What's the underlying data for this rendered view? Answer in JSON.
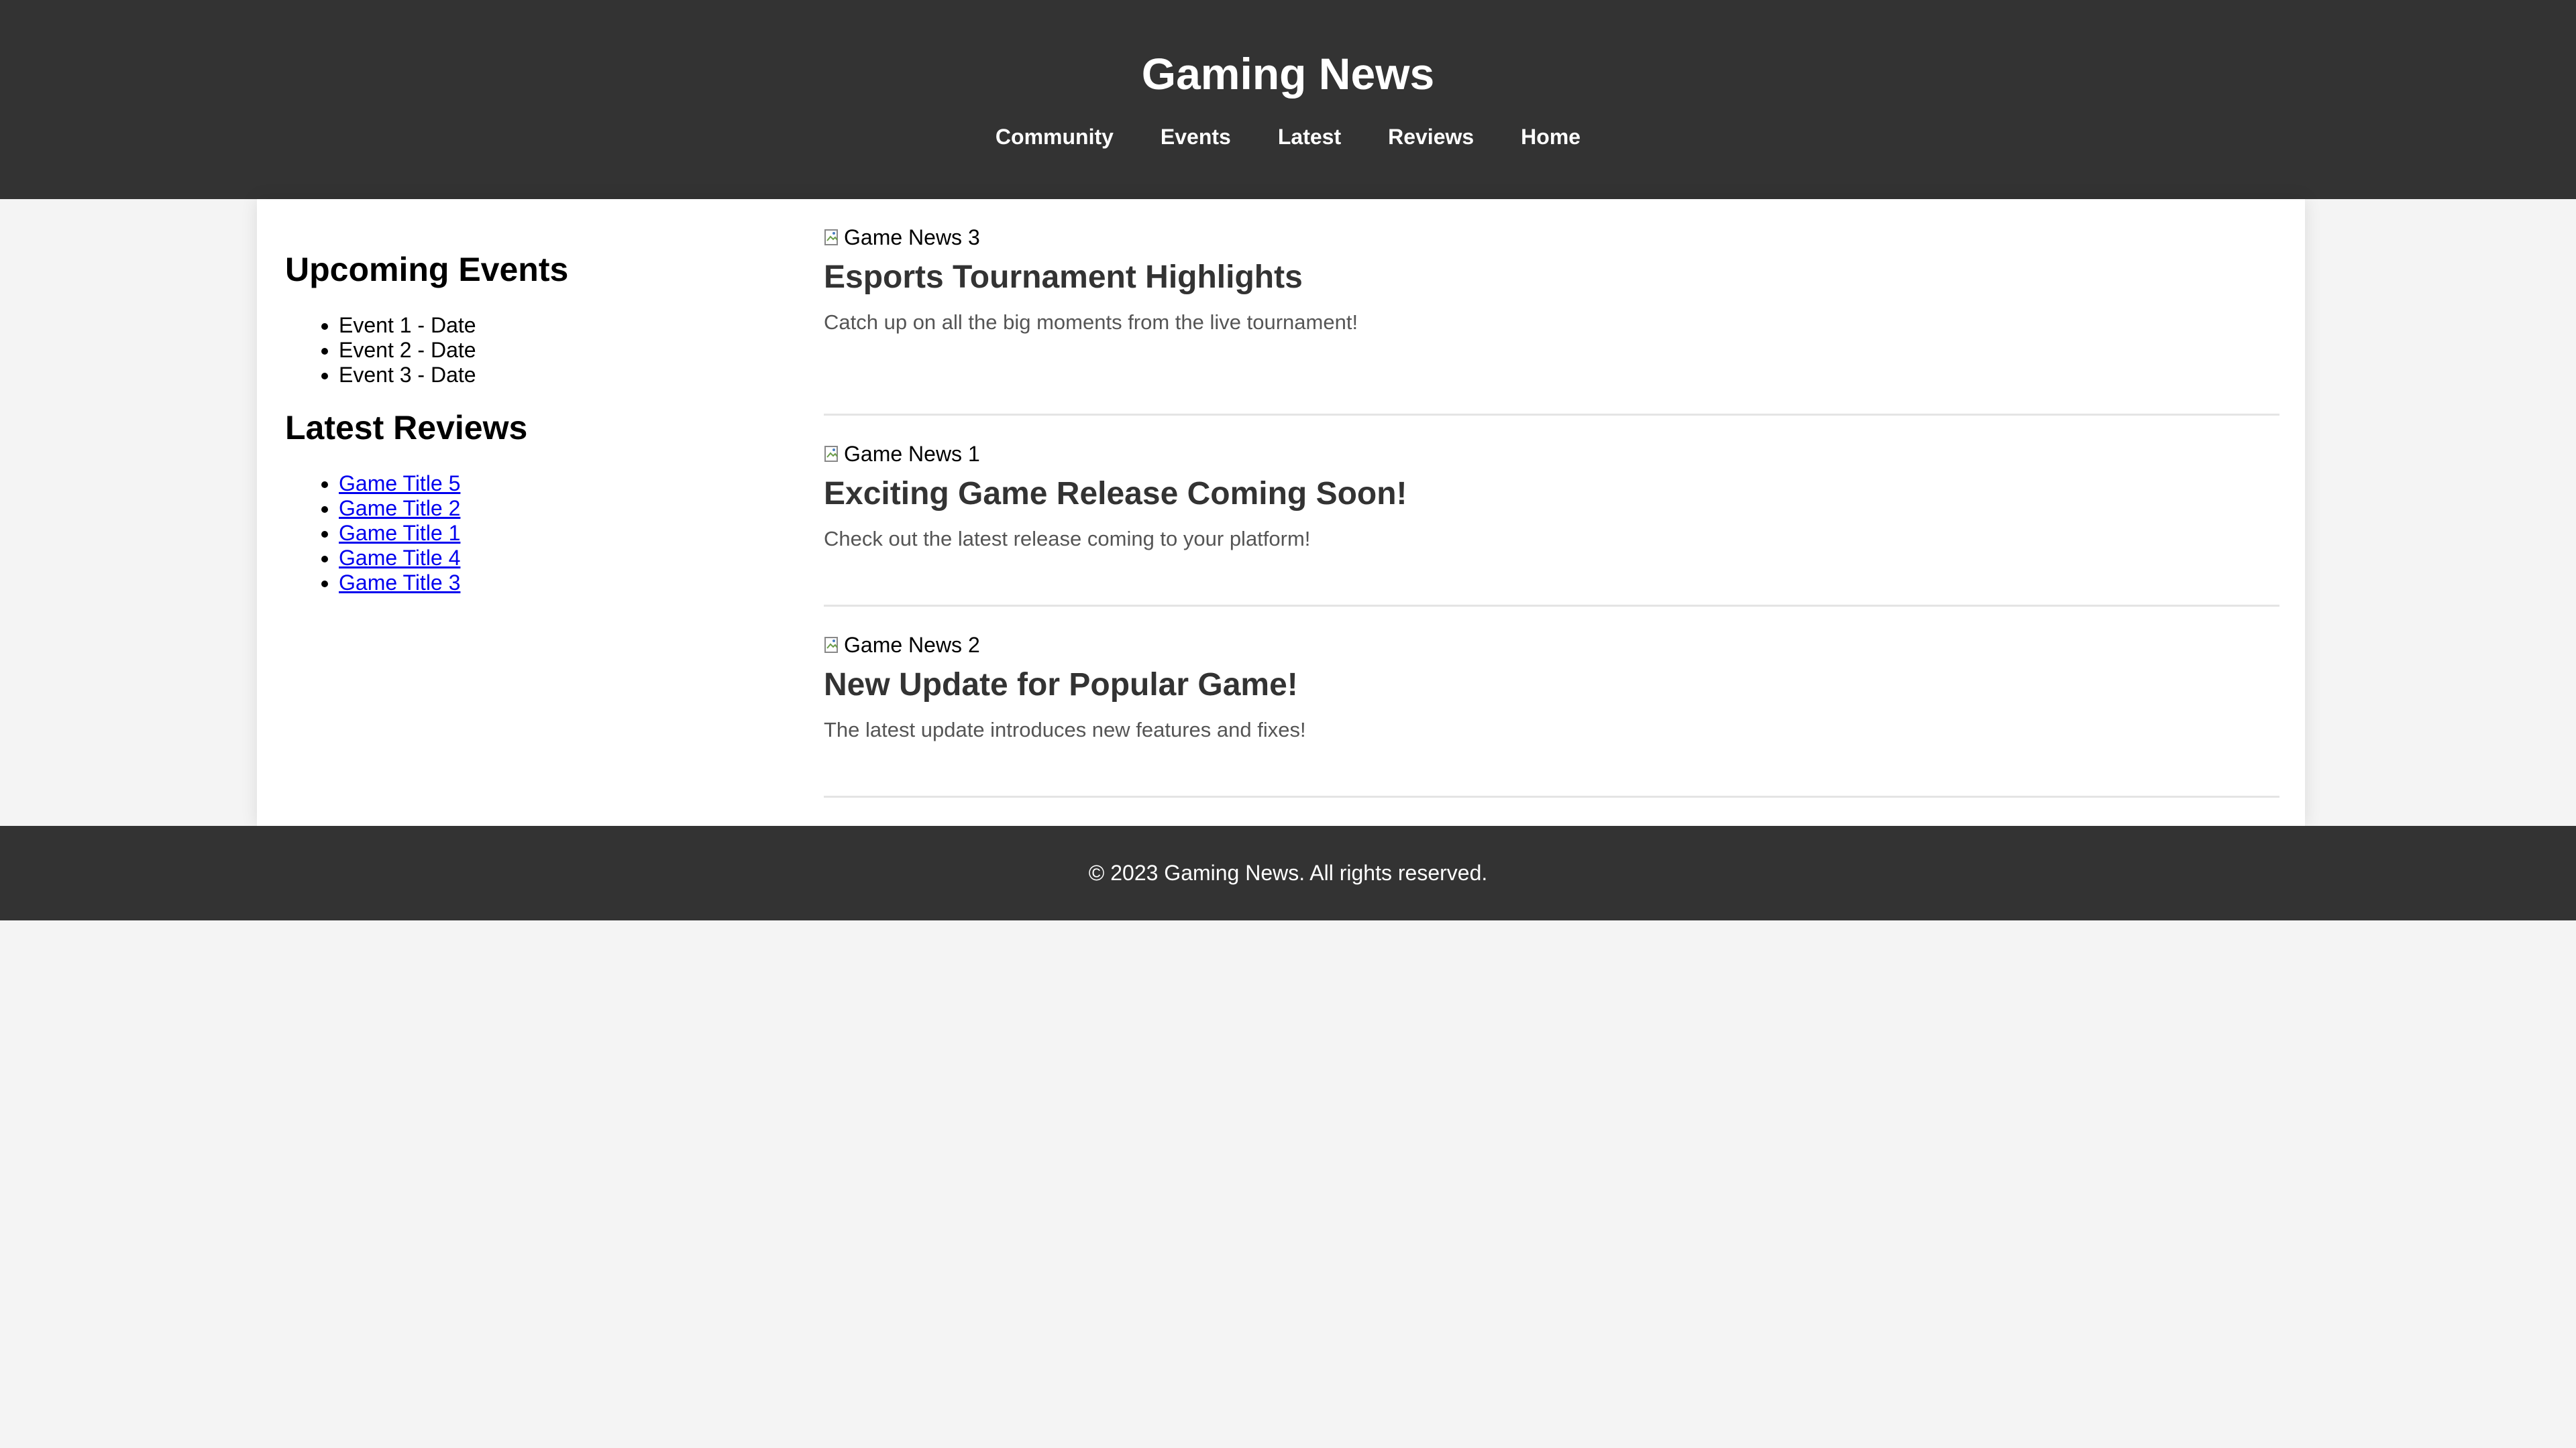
{
  "header": {
    "title": "Gaming News",
    "nav": [
      "Community",
      "Events",
      "Latest",
      "Reviews",
      "Home"
    ]
  },
  "sidebar": {
    "events_heading": "Upcoming Events",
    "events": [
      "Event 1 - Date",
      "Event 2 - Date",
      "Event 3 - Date"
    ],
    "reviews_heading": "Latest Reviews",
    "reviews": [
      "Game Title 5",
      "Game Title 2",
      "Game Title 1",
      "Game Title 4",
      "Game Title 3"
    ]
  },
  "news": [
    {
      "image_alt": "Game News 3",
      "title": "Esports Tournament Highlights",
      "summary": "Catch up on all the big moments from the live tournament!"
    },
    {
      "image_alt": "Game News 1",
      "title": "Exciting Game Release Coming Soon!",
      "summary": "Check out the latest release coming to your platform!"
    },
    {
      "image_alt": "Game News 2",
      "title": "New Update for Popular Game!",
      "summary": "The latest update introduces new features and fixes!"
    }
  ],
  "footer": {
    "text": "© 2023 Gaming News. All rights reserved."
  },
  "colors": {
    "header_bg": "#333333",
    "page_bg": "#f4f4f4",
    "link": "#0000ee",
    "title_text": "#333333",
    "summary_text": "#555555"
  },
  "icons": {
    "broken_image": "broken-image-icon"
  }
}
